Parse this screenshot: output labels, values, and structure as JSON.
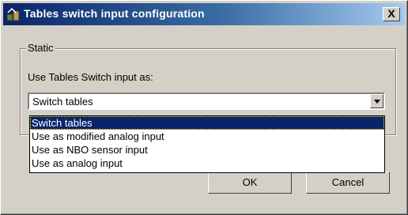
{
  "window": {
    "title": "Tables switch input configuration",
    "close_label": "X"
  },
  "group": {
    "label": "Static"
  },
  "field": {
    "label": "Use Tables Switch input as:"
  },
  "combo": {
    "selected": "Switch tables"
  },
  "dropdown": {
    "options": [
      {
        "label": "Switch tables",
        "selected": true
      },
      {
        "label": "Use as modified analog input",
        "selected": false
      },
      {
        "label": "Use as NBO sensor input",
        "selected": false
      },
      {
        "label": "Use as analog input",
        "selected": false
      }
    ]
  },
  "buttons": {
    "ok": "OK",
    "cancel": "Cancel"
  }
}
